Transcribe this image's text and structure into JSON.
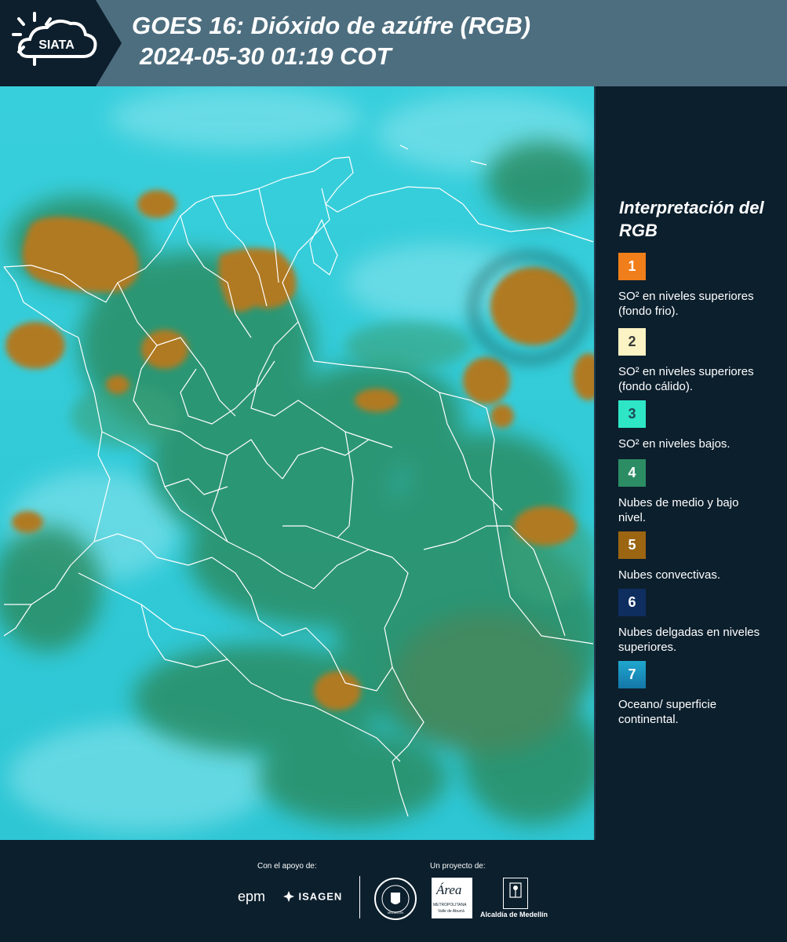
{
  "header": {
    "title_line1": "GOES 16: Dióxido de azúfre (RGB)",
    "title_line2": "2024-05-30 01:19 COT",
    "logo_text": "SIATA"
  },
  "map": {
    "description_icon": "satellite-rgb-image"
  },
  "legend": {
    "title": "Interpretación del RGB",
    "items": [
      {
        "number": "1",
        "color": "#f07e1a",
        "text": "SO² en niveles superiores (fondo frio)."
      },
      {
        "number": "2",
        "color": "#fbf3c3",
        "text": "SO² en niveles superiores (fondo cálido)."
      },
      {
        "number": "3",
        "color": "#2ee6c6",
        "text": "SO² en niveles bajos."
      },
      {
        "number": "4",
        "color": "#2c8d64",
        "text": "Nubes de medio y bajo nivel."
      },
      {
        "number": "5",
        "color": "#9b6512",
        "text": "Nubes convectivas."
      },
      {
        "number": "6",
        "color": "#0e2e60",
        "text": "Nubes delgadas en niveles superiores."
      },
      {
        "number": "7",
        "color": "#1b8fc0",
        "text": "Oceano/ superficie continental."
      }
    ]
  },
  "footer": {
    "support_label": "Con el apoyo de:",
    "project_label": "Un proyecto de:",
    "sponsors": {
      "epm": "epm",
      "isagen": "ISAGEN",
      "area": "Área",
      "area_sub1": "METROPOLITANA",
      "area_sub2": "Valle de Aburrá",
      "medellin_seal": "MEDELLÍN",
      "alcaldia": "Alcaldía de Medellín"
    }
  },
  "colors": {
    "header_bg": "#4d6e7f",
    "panel_bg": "#0c1f2d",
    "ocean": "#2fbfd0",
    "land_green": "#2c8d64",
    "convective": "#9b6512"
  }
}
